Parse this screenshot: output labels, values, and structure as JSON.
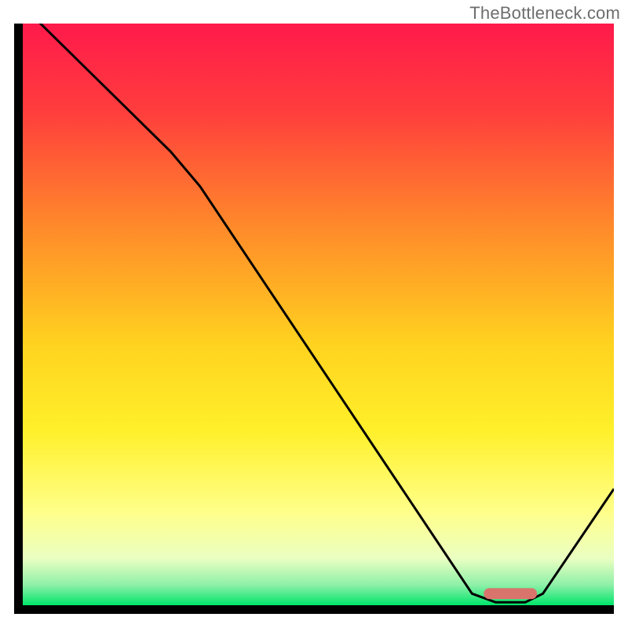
{
  "watermark": "TheBottleneck.com",
  "chart_data": {
    "type": "line",
    "title": "",
    "xlabel": "",
    "ylabel": "",
    "xlim": [
      0,
      100
    ],
    "ylim": [
      0,
      100
    ],
    "grid": false,
    "curve_description": "descending V-shaped curve with slight slope change around x=30, minimum near x=82, rising toward x=100",
    "curve_points": [
      {
        "x": 0,
        "y": 103
      },
      {
        "x": 25,
        "y": 78
      },
      {
        "x": 30,
        "y": 72
      },
      {
        "x": 76,
        "y": 2
      },
      {
        "x": 80,
        "y": 0.5
      },
      {
        "x": 85,
        "y": 0.5
      },
      {
        "x": 88,
        "y": 2
      },
      {
        "x": 100,
        "y": 20
      }
    ],
    "marker": {
      "x_center": 82.5,
      "y": 2,
      "width": 9,
      "color": "#d9746c"
    },
    "gradient_stops": [
      {
        "offset": 0.0,
        "color": "#ff1a4b"
      },
      {
        "offset": 0.15,
        "color": "#ff3d3d"
      },
      {
        "offset": 0.35,
        "color": "#ff8a2a"
      },
      {
        "offset": 0.55,
        "color": "#ffd21f"
      },
      {
        "offset": 0.7,
        "color": "#fff02a"
      },
      {
        "offset": 0.84,
        "color": "#ffff8a"
      },
      {
        "offset": 0.92,
        "color": "#eaffc2"
      },
      {
        "offset": 0.965,
        "color": "#8ef0a8"
      },
      {
        "offset": 1.0,
        "color": "#00e56a"
      }
    ],
    "axis_color": "#000000",
    "axis_width": 11
  }
}
